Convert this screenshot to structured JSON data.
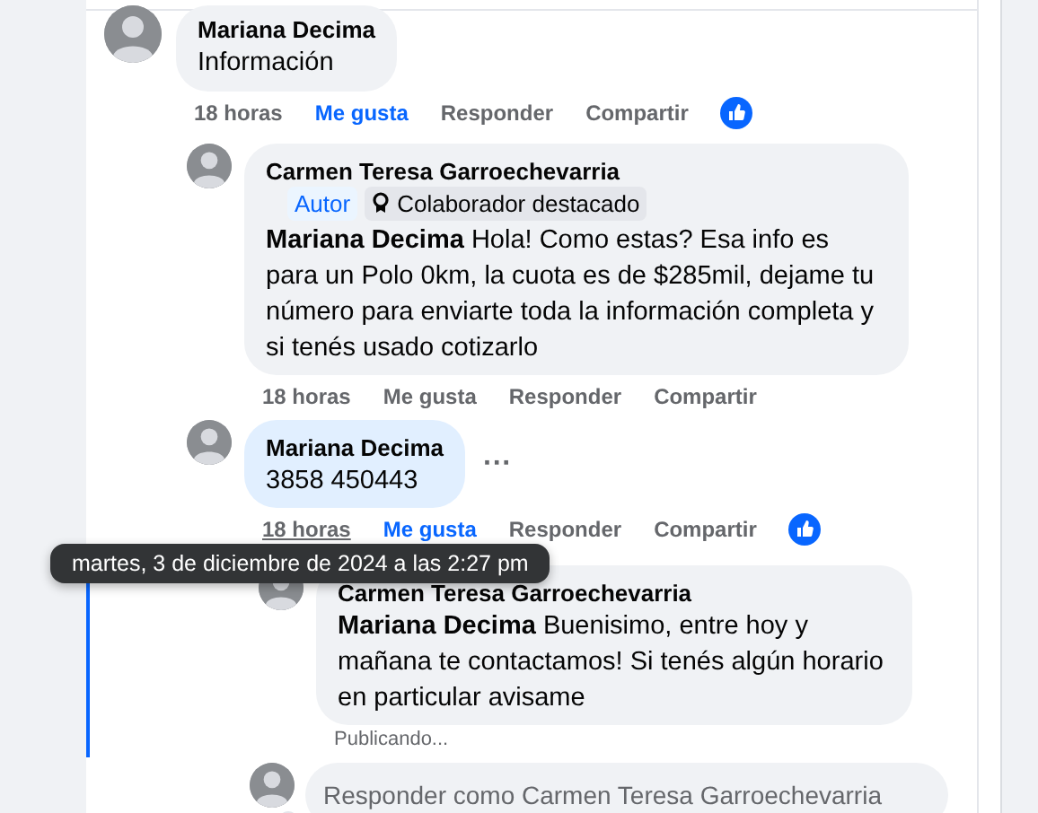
{
  "tooltip": "martes, 3 de diciembre de 2024 a las 2:27 pm",
  "comments": [
    {
      "author": "Mariana Decima",
      "text": "Información",
      "highlighted": false,
      "time": "18 horas",
      "time_hovered": false,
      "like": "Me gusta",
      "liked": true,
      "reply": "Responder",
      "share": "Compartir",
      "reacted": true,
      "replies": [
        {
          "author": "Carmen Teresa Garroechevarria",
          "badges": [
            {
              "label": "Autor",
              "kind": "role"
            },
            {
              "label": "Colaborador destacado",
              "kind": "award"
            }
          ],
          "text": "**Mariana Decima** Hola! Como estas? Esa info es para un Polo 0km, la cuota es de $285mil, dejame tu número para enviarte toda la información completa y si tenés usado cotizarlo",
          "highlighted": false,
          "time": "18 horas",
          "time_hovered": false,
          "like": "Me gusta",
          "liked": false,
          "reply": "Responder",
          "share": "Compartir",
          "reacted": false
        },
        {
          "author": "Mariana Decima",
          "text": "3858 450443",
          "highlighted": true,
          "more": "···",
          "time": "18 horas",
          "time_hovered": true,
          "like": "Me gusta",
          "liked": true,
          "reply": "Responder",
          "share": "Compartir",
          "reacted": true,
          "replies": [
            {
              "author": "Carmen Teresa Garroechevarria",
              "text": "**Mariana Decima** Buenisimo, entre hoy y mañana te contactamos! Si tenés algún horario en particular avisame",
              "highlighted": false,
              "status": "Publicando..."
            }
          ],
          "reply_box": {
            "placeholder": "Responder como Carmen Teresa Garroechevarria"
          }
        }
      ]
    }
  ]
}
